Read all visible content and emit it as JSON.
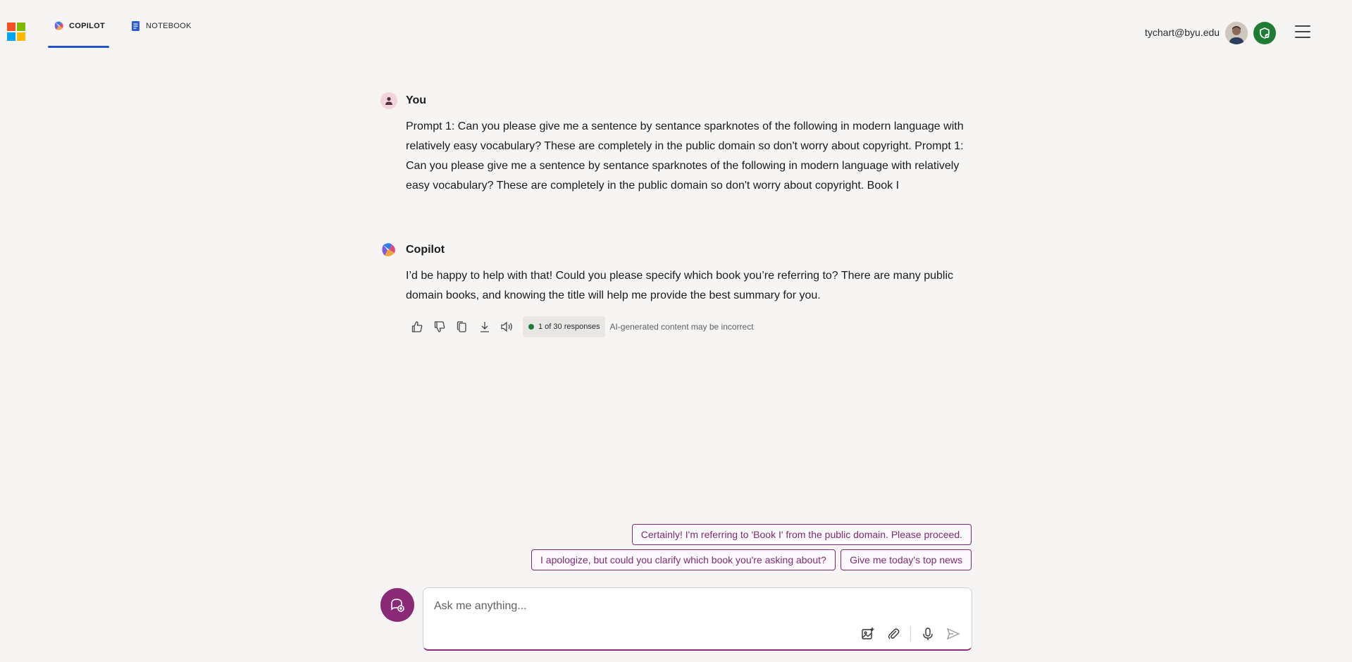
{
  "header": {
    "tabs": [
      {
        "label": "COPILOT",
        "icon": "copilot-icon",
        "active": true
      },
      {
        "label": "NOTEBOOK",
        "icon": "notebook-icon",
        "active": false
      }
    ],
    "user_email": "tychart@byu.edu"
  },
  "conversation": [
    {
      "author": "You",
      "text": "Prompt 1: Can you please give me a sentence by sentance sparknotes of the following in modern language with relatively easy vocabulary? These are completely in the public domain so don't worry about copyright. Prompt 1: Can you please give me a sentence by sentance sparknotes of the following in modern language with relatively easy vocabulary? These are completely in the public domain so don't worry about copyright. Book I"
    },
    {
      "author": "Copilot",
      "text": "I’d be happy to help with that! Could you please specify which book you’re referring to? There are many public domain books, and knowing the title will help me provide the best summary for you."
    }
  ],
  "response_actions": {
    "icons": [
      "thumbs-up-icon",
      "thumbs-down-icon",
      "copy-icon",
      "download-icon",
      "read-aloud-icon"
    ],
    "response_count": "1 of 30 responses",
    "disclaimer": "AI-generated content may be incorrect"
  },
  "suggestions": [
    "Certainly! I'm referring to 'Book I' from the public domain. Please proceed.",
    "I apologize, but could you clarify which book you're asking about?",
    "Give me today's top news"
  ],
  "input": {
    "placeholder": "Ask me anything...",
    "value": ""
  },
  "colors": {
    "accent": "#8a2a77",
    "suggestion_text": "#7e2a72",
    "tab_underline": "#2353c7",
    "badge_green": "#1e7c35"
  }
}
